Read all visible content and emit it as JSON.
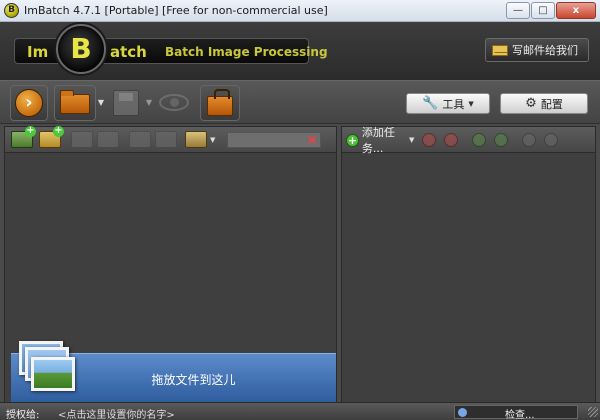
{
  "window": {
    "title": "ImBatch 4.7.1 [Portable] [Free for non-commercial use]",
    "app_icon_letter": "B",
    "minimize": "—",
    "maximize": "□",
    "close": "x"
  },
  "header": {
    "logo_im": "Im",
    "logo_b": "B",
    "logo_atch": "atch",
    "logo_subtitle": "Batch Image Processing",
    "mail_label": "写邮件给我们"
  },
  "toolbar": {
    "run_icon": "›",
    "tools_label": "工具",
    "settings_label": "配置",
    "dropdown_arrow": "▼"
  },
  "left_panel": {
    "drop_text": "拖放文件到这儿",
    "clear_icon": "✖"
  },
  "right_panel": {
    "add_task_label": "添加任务...",
    "plus": "+"
  },
  "statusbar": {
    "license_label": "授权给:",
    "license_name": "<点击这里设置你的名字>",
    "check_label": "检查..."
  },
  "icons": {
    "wrench": "🔧",
    "gear": "⚙",
    "caret": "▼"
  }
}
